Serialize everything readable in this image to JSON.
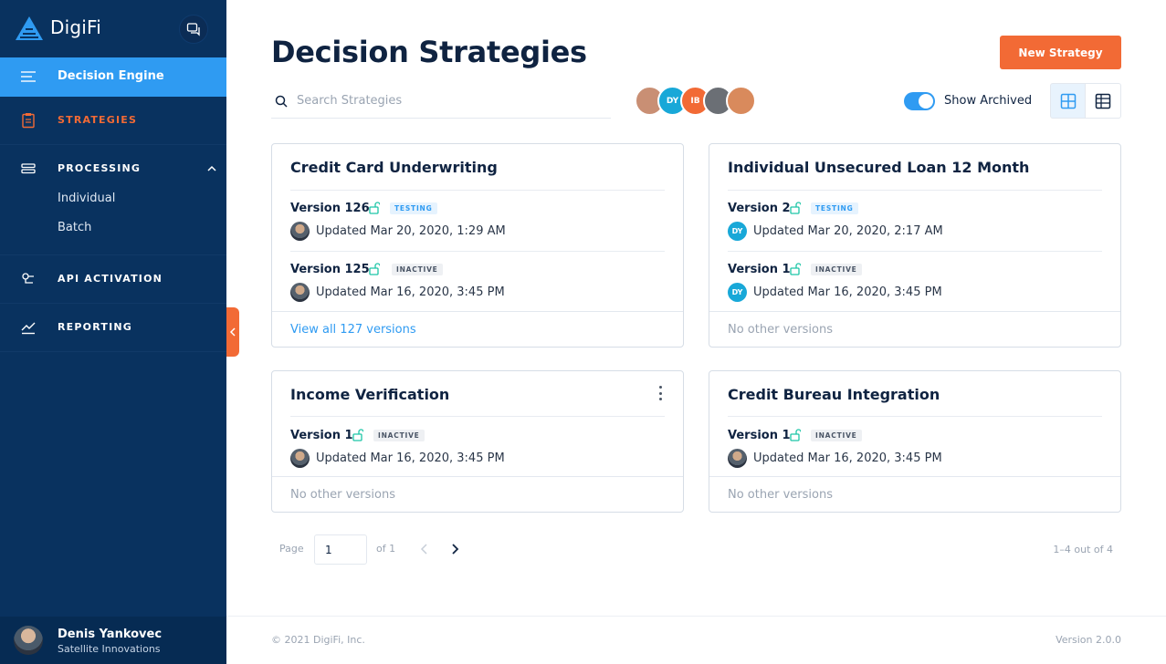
{
  "app": {
    "name": "DigiFi"
  },
  "sidebar": {
    "active_item": "Decision Engine",
    "items": [
      {
        "label": "STRATEGIES",
        "color": "#f26a35"
      },
      {
        "label": "PROCESSING"
      },
      {
        "label": "API ACTIVATION"
      },
      {
        "label": "REPORTING"
      }
    ],
    "processing_sub": [
      "Individual",
      "Batch"
    ],
    "user": {
      "name": "Denis Yankovec",
      "org": "Satellite Innovations"
    }
  },
  "page": {
    "title": "Decision Strategies",
    "new_button": "New Strategy",
    "search_placeholder": "Search Strategies",
    "avatars": [
      {
        "initials": "",
        "color": "#c98f74"
      },
      {
        "initials": "DY",
        "color": "#18a8d8"
      },
      {
        "initials": "IB",
        "color": "#f26a35"
      },
      {
        "initials": "",
        "color": "#6b6f75"
      },
      {
        "initials": "",
        "color": "#d98a5c"
      }
    ],
    "show_archived_label": "Show Archived",
    "show_archived": true
  },
  "cards": [
    {
      "title": "Credit Card Underwriting",
      "versions": [
        {
          "name": "Version 126",
          "status": "TESTING",
          "updated": "Updated Mar 20, 2020, 1:29 AM",
          "avatar": "photo"
        },
        {
          "name": "Version 125",
          "status": "INACTIVE",
          "updated": "Updated Mar 16, 2020, 3:45 PM",
          "avatar": "photo"
        }
      ],
      "footer": "View all 127 versions"
    },
    {
      "title": "Individual Unsecured Loan 12 Month",
      "versions": [
        {
          "name": "Version 2",
          "status": "TESTING",
          "updated": "Updated Mar 20, 2020, 2:17 AM",
          "avatar": "DY"
        },
        {
          "name": "Version 1",
          "status": "INACTIVE",
          "updated": "Updated Mar 16, 2020, 3:45 PM",
          "avatar": "DY"
        }
      ],
      "footer": "No other versions"
    },
    {
      "title": "Income Verification",
      "versions": [
        {
          "name": "Version 1",
          "status": "INACTIVE",
          "updated": "Updated Mar 16, 2020, 3:45 PM",
          "avatar": "photo"
        }
      ],
      "footer": "No other versions"
    },
    {
      "title": "Credit Bureau Integration",
      "versions": [
        {
          "name": "Version 1",
          "status": "INACTIVE",
          "updated": "Updated Mar 16, 2020, 3:45 PM",
          "avatar": "photo"
        }
      ],
      "footer": "No other versions"
    }
  ],
  "pagination": {
    "page_label": "Page",
    "page": "1",
    "of_label": "of 1",
    "count": "1–4 out of 4"
  },
  "footer": {
    "copyright": "© 2021 DigiFi, Inc.",
    "version": "Version 2.0.0"
  }
}
